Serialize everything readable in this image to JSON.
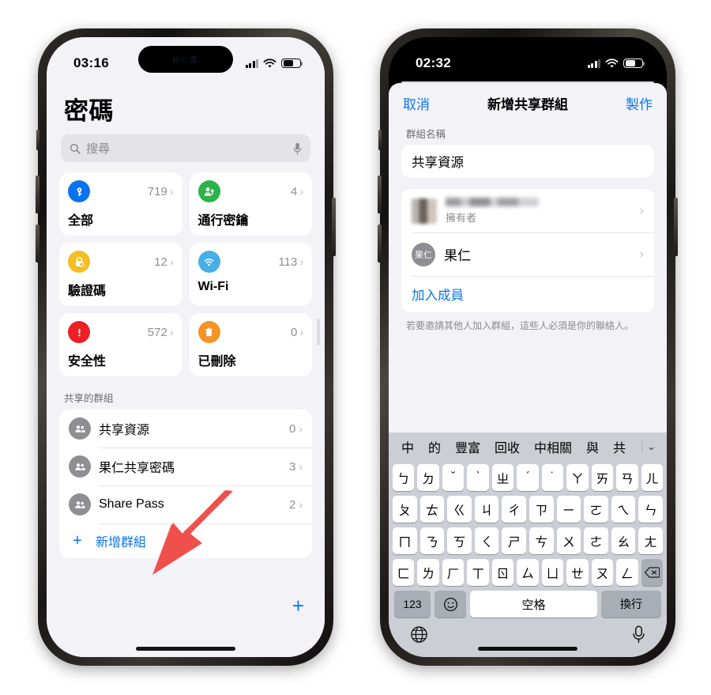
{
  "left_phone": {
    "status_bar": {
      "time": "03:16",
      "island_text": "紀仁霆"
    },
    "page_title": "密碼",
    "search": {
      "placeholder": "搜尋",
      "icon": "search-icon",
      "mic_icon": "microphone-icon"
    },
    "categories": [
      {
        "id": "all",
        "label": "全部",
        "count": "719",
        "icon": "key-circle-icon",
        "color": "#0a74f0"
      },
      {
        "id": "passkeys",
        "label": "通行密鑰",
        "count": "4",
        "icon": "person-key-icon",
        "color": "#2bb34a"
      },
      {
        "id": "codes",
        "label": "驗證碼",
        "count": "12",
        "icon": "lock-clock-icon",
        "color": "#f5bf23"
      },
      {
        "id": "wifi",
        "label": "Wi-Fi",
        "count": "113",
        "icon": "wifi-icon",
        "color": "#46b0e6"
      },
      {
        "id": "security",
        "label": "安全性",
        "count": "572",
        "icon": "exclamation-icon",
        "color": "#ec1f26"
      },
      {
        "id": "deleted",
        "label": "已刪除",
        "count": "0",
        "icon": "trash-icon",
        "color": "#f59325"
      }
    ],
    "shared_section": {
      "header": "共享的群組",
      "groups": [
        {
          "name": "共享資源",
          "count": "0",
          "icon": "people-icon"
        },
        {
          "name": "果仁共享密碼",
          "count": "3",
          "icon": "people-icon"
        },
        {
          "name": "Share Pass",
          "count": "2",
          "icon": "people-icon"
        }
      ],
      "add_label": "新增群組",
      "add_icon": "plus-icon"
    },
    "fab": {
      "icon": "plus-icon",
      "label": "+"
    },
    "annotation": {
      "type": "arrow",
      "color": "#f0504c",
      "points_to": "新增群組"
    }
  },
  "right_phone": {
    "status_bar": {
      "time": "02:32",
      "island_text": ""
    },
    "nav": {
      "cancel": "取消",
      "title": "新增共享群組",
      "create": "製作"
    },
    "form": {
      "group_name_label": "群組名稱",
      "group_name_value": "共享資源"
    },
    "members": [
      {
        "name": "",
        "subtitle": "擁有者",
        "blurred": true,
        "avatar_text": ""
      },
      {
        "name": "果仁",
        "subtitle": "",
        "blurred": false,
        "avatar_text": "果仁"
      }
    ],
    "add_member_label": "加入成員",
    "hint": "若要邀請其他人加入群組，這些人必須是你的聯絡人。",
    "keyboard": {
      "suggestions": [
        "中",
        "的",
        "豐富",
        "回收",
        "中相關",
        "與",
        "共"
      ],
      "collapse_icon": "chevron-down-icon",
      "rows": [
        [
          "ㄅ",
          "ㄉ",
          "ˇ",
          "ˋ",
          "ㄓ",
          "ˊ",
          "˙",
          "ㄚ",
          "ㄞ",
          "ㄢ",
          "ㄦ"
        ],
        [
          "ㄆ",
          "ㄊ",
          "ㄍ",
          "ㄐ",
          "ㄔ",
          "ㄗ",
          "ㄧ",
          "ㄛ",
          "ㄟ",
          "ㄣ"
        ],
        [
          "ㄇ",
          "ㄋ",
          "ㄎ",
          "ㄑ",
          "ㄕ",
          "ㄘ",
          "ㄨ",
          "ㄜ",
          "ㄠ",
          "ㄤ"
        ],
        [
          "ㄈ",
          "ㄌ",
          "ㄏ",
          "ㄒ",
          "ㄖ",
          "ㄙ",
          "ㄩ",
          "ㄝ",
          "ㄡ",
          "ㄥ"
        ]
      ],
      "backspace_icon": "backspace-icon",
      "bottom": {
        "numbers": "123",
        "emoji_icon": "emoji-icon",
        "space": "空格",
        "return": "換行",
        "globe_icon": "globe-icon",
        "dictation_icon": "microphone-icon"
      }
    }
  }
}
